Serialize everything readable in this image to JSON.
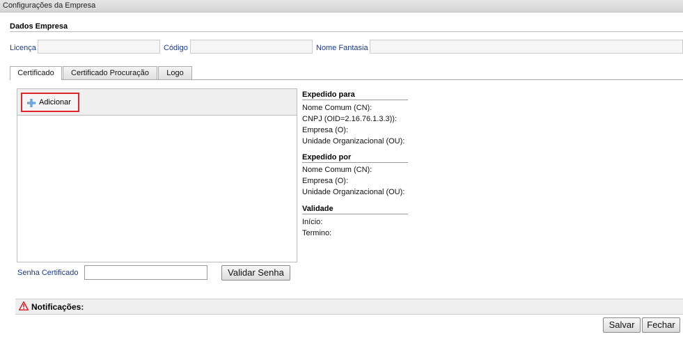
{
  "window": {
    "title": "Configurações da Empresa"
  },
  "dados_empresa": {
    "section_title": "Dados Empresa",
    "licenca_label": "Licença",
    "licenca_value": "",
    "codigo_label": "Código",
    "codigo_value": "",
    "nome_fantasia_label": "Nome Fantasia",
    "nome_fantasia_value": ""
  },
  "tabs": [
    {
      "label": "Certificado",
      "active": true
    },
    {
      "label": "Certificado Procuração",
      "active": false
    },
    {
      "label": "Logo",
      "active": false
    }
  ],
  "certificado": {
    "add_label": "Adicionar",
    "add_icon": "plus-icon",
    "expedido_para": {
      "title": "Expedido para",
      "lines": [
        "Nome Comum (CN):",
        "CNPJ (OID=2.16.76.1.3.3)):",
        "Empresa (O):",
        "Unidade Organizacional (OU):"
      ]
    },
    "expedido_por": {
      "title": "Expedido por",
      "lines": [
        "Nome Comum (CN):",
        "Empresa (O):",
        "Unidade Organizacional (OU):"
      ]
    },
    "validade": {
      "title": "Validade",
      "lines": [
        "Início:",
        "Termino:"
      ]
    },
    "senha_label": "Senha Certificado",
    "senha_value": "",
    "validar_label": "Validar Senha"
  },
  "notificacoes": {
    "label": "Notificações:",
    "icon": "warning-icon",
    "icon_color": "#d9262c"
  },
  "footer": {
    "salvar_label": "Salvar",
    "fechar_label": "Fechar"
  },
  "colors": {
    "label_blue": "#1a3a8a",
    "highlight_red": "#e0242b"
  }
}
